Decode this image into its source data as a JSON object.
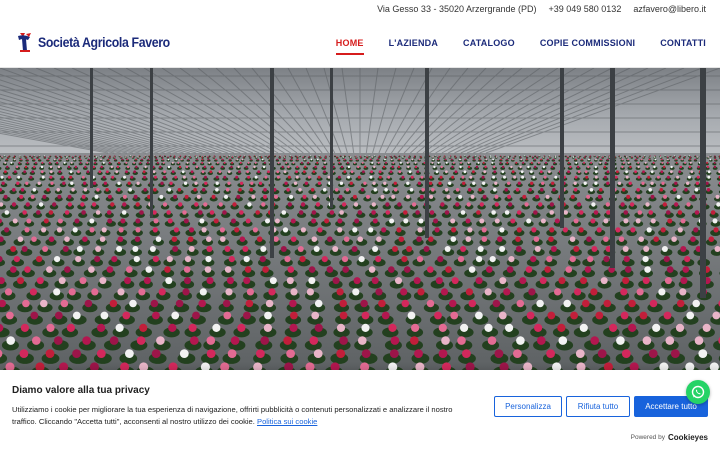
{
  "topbar": {
    "address": "Via Gesso 33 - 35020 Arzergrande (PD)",
    "phone": "+39 049 580 0132",
    "email": "azfavero@libero.it"
  },
  "header": {
    "brand": "Società Agricola Favero",
    "nav": [
      {
        "label": "HOME",
        "active": true
      },
      {
        "label": "L'AZIENDA",
        "active": false
      },
      {
        "label": "CATALOGO",
        "active": false
      },
      {
        "label": "COPIE COMMISSIONI",
        "active": false
      },
      {
        "label": "CONTATTI",
        "active": false
      }
    ]
  },
  "cookie_banner": {
    "title": "Diamo valore alla tua privacy",
    "text": "Utilizziamo i cookie per migliorare la tua esperienza di navigazione, offrirti pubblicità o contenuti personalizzati e analizzare il nostro traffico. Cliccando \"Accetta tutti\", acconsenti al nostro utilizzo dei cookie.",
    "policy_link": "Politica sui cookie",
    "customize_label": "Personalizza",
    "reject_label": "Rifiuta tutto",
    "accept_label": "Accettare tutto",
    "powered_by": "Powered by",
    "powered_brand": "Cookieyes"
  },
  "colors": {
    "brand": "#1b2a7a",
    "accent": "#d61c1c",
    "button": "#1863dc",
    "whatsapp": "#25d366"
  },
  "icons": [
    "logo-icon",
    "whatsapp-icon"
  ]
}
